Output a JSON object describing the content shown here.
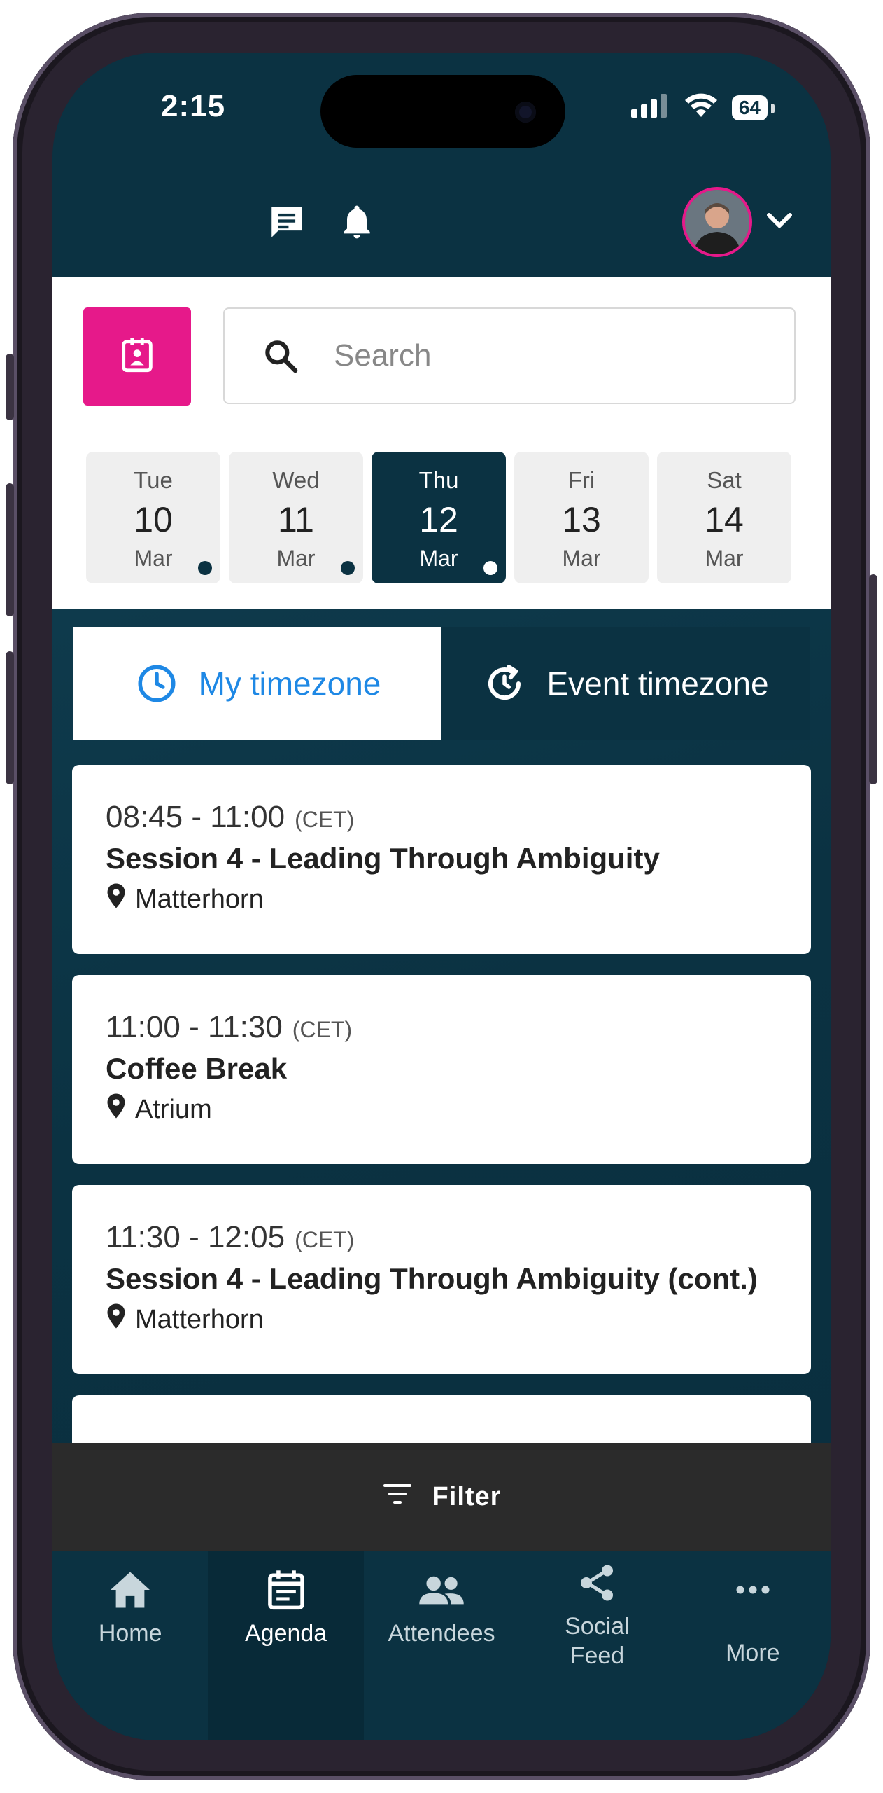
{
  "status_bar": {
    "time": "2:15",
    "battery": "64"
  },
  "header": {
    "avatar_alt": "User profile photo"
  },
  "search": {
    "placeholder": "Search"
  },
  "dates": [
    {
      "dow": "Tue",
      "num": "10",
      "mon": "Mar",
      "selected": false,
      "has_dot": true
    },
    {
      "dow": "Wed",
      "num": "11",
      "mon": "Mar",
      "selected": false,
      "has_dot": true
    },
    {
      "dow": "Thu",
      "num": "12",
      "mon": "Mar",
      "selected": true,
      "has_dot": true
    },
    {
      "dow": "Fri",
      "num": "13",
      "mon": "Mar",
      "selected": false,
      "has_dot": false
    },
    {
      "dow": "Sat",
      "num": "14",
      "mon": "Mar",
      "selected": false,
      "has_dot": false
    }
  ],
  "timezone_toggle": {
    "my_label": "My timezone",
    "event_label": "Event timezone",
    "active": "my"
  },
  "sessions": [
    {
      "time": "08:45 - 11:00",
      "tz": "(CET)",
      "title": "Session 4 - Leading Through Ambiguity",
      "location": "Matterhorn"
    },
    {
      "time": "11:00 - 11:30",
      "tz": "(CET)",
      "title": "Coffee Break",
      "location": "Atrium"
    },
    {
      "time": "11:30 - 12:05",
      "tz": "(CET)",
      "title": "Session 4 - Leading Through Ambiguity (cont.)",
      "location": "Matterhorn"
    }
  ],
  "filter": {
    "label": "Filter"
  },
  "bottom_nav": [
    {
      "label": "Home",
      "icon": "home-icon"
    },
    {
      "label": "Agenda",
      "icon": "agenda-icon"
    },
    {
      "label": "Attendees",
      "icon": "attendees-icon"
    },
    {
      "label": "Social Feed",
      "icon": "share-icon"
    },
    {
      "label": "More",
      "icon": "more-icon"
    }
  ],
  "colors": {
    "brand_dark": "#0b3242",
    "accent_pink": "#e6198a",
    "active_blue": "#1e88e5",
    "filter_bar": "#2b2b2b"
  }
}
